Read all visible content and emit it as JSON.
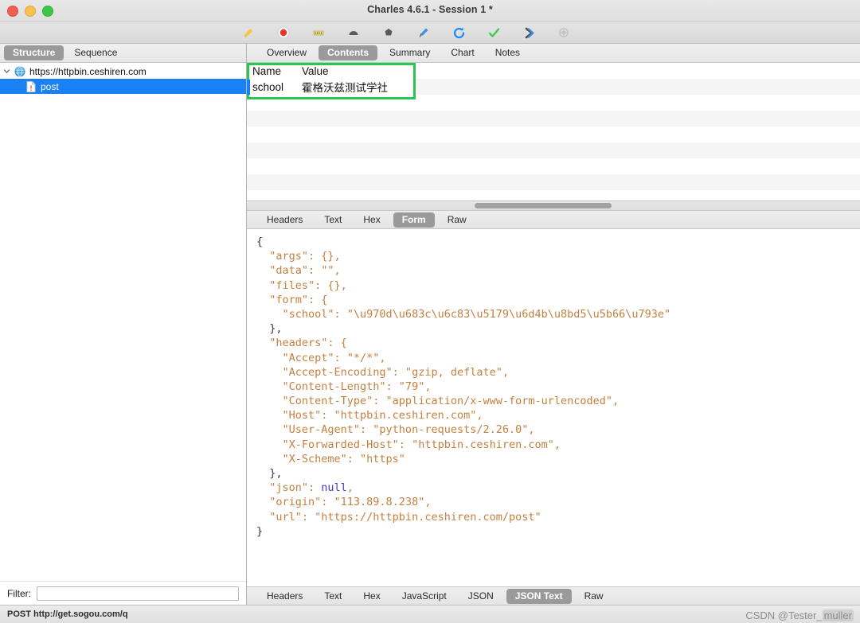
{
  "window": {
    "title": "Charles 4.6.1 - Session 1 *",
    "controls": [
      "close",
      "minimize",
      "zoom"
    ]
  },
  "toolbar": {
    "buttons": [
      {
        "name": "clear-session-icon",
        "label": "Clear Session"
      },
      {
        "name": "record-icon",
        "label": "Start/Stop Recording"
      },
      {
        "name": "throttle-icon",
        "label": "Throttle Settings"
      },
      {
        "name": "breakpoints-icon",
        "label": "Breakpoints Settings"
      },
      {
        "name": "compose-icon",
        "label": "Compose"
      },
      {
        "name": "edit-icon",
        "label": "Compose a New Request"
      },
      {
        "name": "repeat-icon",
        "label": "Repeat"
      },
      {
        "name": "validate-icon",
        "label": "Validate"
      },
      {
        "name": "tools-icon",
        "label": "Tools"
      },
      {
        "name": "settings-icon",
        "label": "Settings"
      }
    ]
  },
  "sidebar": {
    "tabs": [
      {
        "label": "Structure",
        "active": true
      },
      {
        "label": "Sequence",
        "active": false
      }
    ],
    "tree": [
      {
        "label": "https://httpbin.ceshiren.com",
        "level": 0,
        "selected": false,
        "expanded": true,
        "icon": "globe-icon"
      },
      {
        "label": "post",
        "level": 1,
        "selected": true,
        "expanded": false,
        "icon": "file-icon"
      }
    ],
    "filter": {
      "label": "Filter:",
      "value": "",
      "placeholder": ""
    }
  },
  "detail": {
    "top_tabs": [
      {
        "label": "Overview",
        "active": false
      },
      {
        "label": "Contents",
        "active": true
      },
      {
        "label": "Summary",
        "active": false
      },
      {
        "label": "Chart",
        "active": false
      },
      {
        "label": "Notes",
        "active": false
      }
    ],
    "contents_table": {
      "columns": [
        "Name",
        "Value"
      ],
      "rows": [
        {
          "name": "school",
          "value": "霍格沃兹测试学社"
        }
      ],
      "highlight_color": "#29c650"
    },
    "request_tabs": [
      {
        "label": "Headers",
        "active": false
      },
      {
        "label": "Text",
        "active": false
      },
      {
        "label": "Hex",
        "active": false
      },
      {
        "label": "Form",
        "active": true
      },
      {
        "label": "Raw",
        "active": false
      }
    ],
    "response_tabs": [
      {
        "label": "Headers",
        "active": false
      },
      {
        "label": "Text",
        "active": false
      },
      {
        "label": "Hex",
        "active": false
      },
      {
        "label": "JavaScript",
        "active": false
      },
      {
        "label": "JSON",
        "active": false
      },
      {
        "label": "JSON Text",
        "active": true
      },
      {
        "label": "Raw",
        "active": false
      }
    ],
    "json_lines": [
      "{",
      "  \"args\": {},",
      "  \"data\": \"\",",
      "  \"files\": {},",
      "  \"form\": {",
      "    \"school\": \"\\u970d\\u683c\\u6c83\\u5179\\u6d4b\\u8bd5\\u5b66\\u793e\"",
      "  },",
      "  \"headers\": {",
      "    \"Accept\": \"*/*\",",
      "    \"Accept-Encoding\": \"gzip, deflate\",",
      "    \"Content-Length\": \"79\",",
      "    \"Content-Type\": \"application/x-www-form-urlencoded\",",
      "    \"Host\": \"httpbin.ceshiren.com\",",
      "    \"User-Agent\": \"python-requests/2.26.0\",",
      "    \"X-Forwarded-Host\": \"httpbin.ceshiren.com\",",
      "    \"X-Scheme\": \"https\"",
      "  },",
      "  \"json\": null,",
      "  \"origin\": \"113.89.8.238\",",
      "  \"url\": \"https://httpbin.ceshiren.com/post\"",
      "}"
    ]
  },
  "statusbar": {
    "text": "POST http://get.sogou.com/q"
  },
  "watermark": {
    "prefix": "CSDN @Tester_",
    "suffix": "muller"
  }
}
